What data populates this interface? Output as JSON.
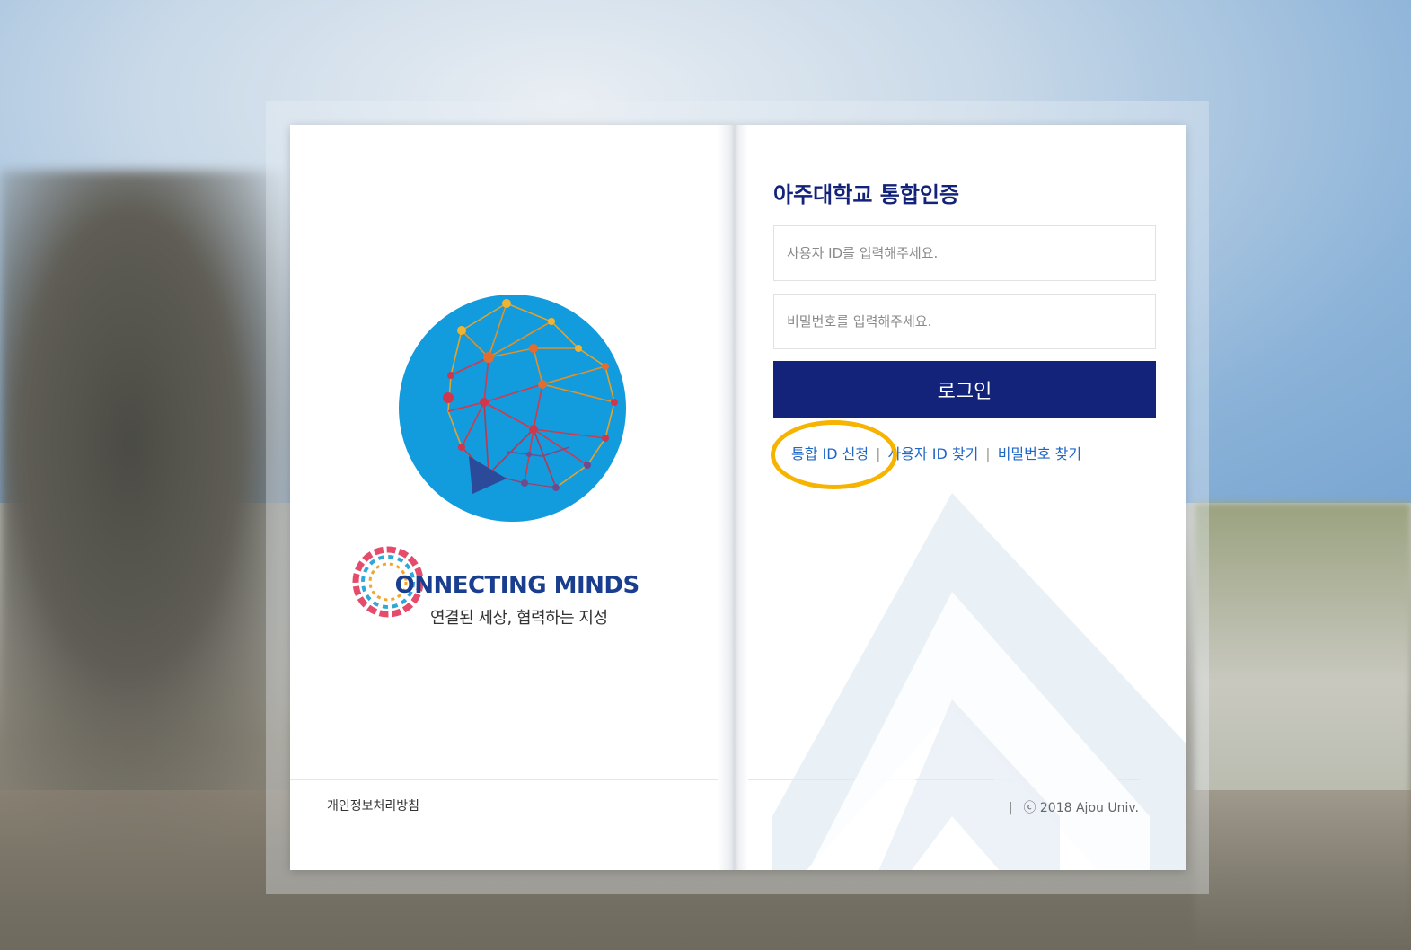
{
  "left_panel": {
    "connecting_minds_title": "ONNECTING MINDS",
    "connecting_minds_title_first_letter": "C",
    "connecting_minds_slogan": "연결된 세상, 협력하는 지성",
    "privacy_link": "개인정보처리방침"
  },
  "login": {
    "title": "아주대학교 통합인증",
    "id_placeholder": "사용자 ID를 입력해주세요.",
    "id_value": "",
    "password_placeholder": "비밀번호를 입력해주세요.",
    "password_value": "",
    "login_button": "로그인",
    "links": {
      "register": "통합 ID 신청",
      "find_id": "사용자 ID 찾기",
      "find_password": "비밀번호 찾기",
      "separator": "|"
    }
  },
  "footer": {
    "separator": "|",
    "copyright": "ⓒ 2018 Ajou Univ."
  },
  "colors": {
    "primary_navy": "#14237a",
    "link_blue": "#1f66c5",
    "emblem_blue": "#129bdd",
    "highlight_ring": "#f6b300"
  },
  "icons": {
    "emblem": "ajou-network-emblem-icon",
    "connecting_minds_ring": "connecting-minds-ring-icon",
    "watermark": "ajou-watermark-icon"
  }
}
